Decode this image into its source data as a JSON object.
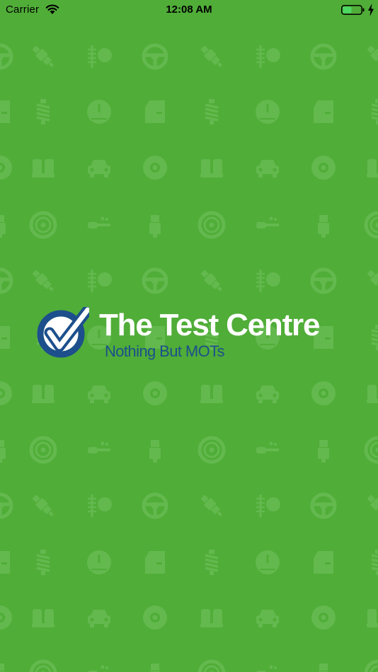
{
  "status_bar": {
    "carrier": "Carrier",
    "time": "12:08 AM",
    "wifi_icon": "wifi-icon",
    "battery_icon": "battery-icon",
    "charging_icon": "charging-bolt-icon",
    "battery_color": "#4cd964"
  },
  "brand": {
    "name": "The Test Centre",
    "tagline": "Nothing But MOTs",
    "logo_icon": "checkmark-circle-icon",
    "ring_color": "#1c4f8c",
    "title_color": "#ffffff",
    "tagline_color": "#1c4f8c"
  },
  "background": {
    "color": "#50ad38",
    "pattern_color": "#63b94e",
    "pattern_icons": [
      "steering-wheel-icon",
      "spark-plug-icon",
      "wiper-icon",
      "car-door-icon",
      "shock-absorber-icon",
      "speedometer-icon",
      "brake-disc-icon",
      "car-seats-icon",
      "car-front-icon",
      "seatbelt-icon",
      "wheel-icon",
      "exhaust-icon"
    ]
  }
}
